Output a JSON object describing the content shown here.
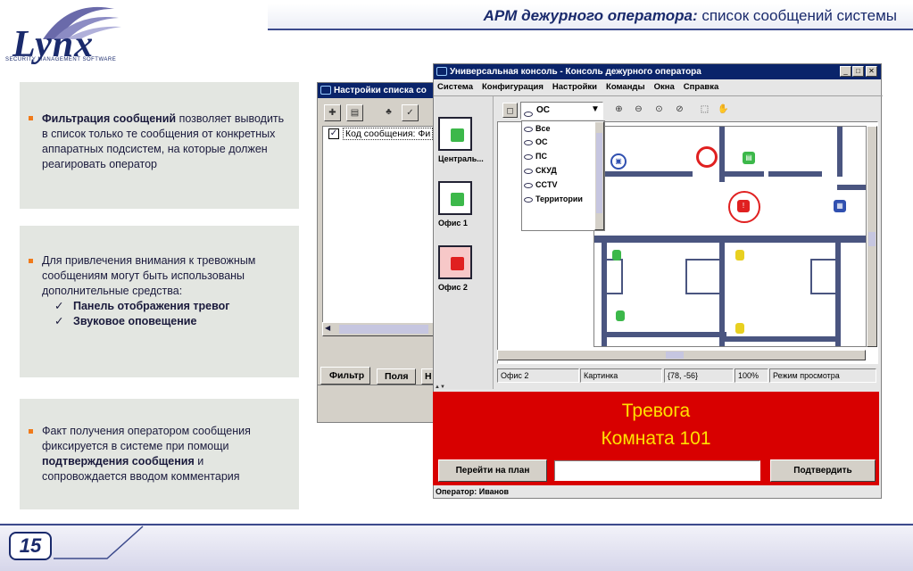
{
  "header": {
    "title_bold": "АРМ дежурного оператора:",
    "title_rest": " список сообщений системы"
  },
  "logo": {
    "name": "Lynx",
    "subtitle": "SECURITY MANAGEMENT SOFTWARE"
  },
  "panels": [
    {
      "bold": "Фильтрация сообщений",
      "text": " позволяет выводить в список только те сообщения от конкретных аппаратных подсистем, на которые должен реагировать оператор"
    },
    {
      "text": "Для привлечения внимания к тревожным сообщениям могут быть использованы дополнительные средства:",
      "checks": [
        "Панель отображения тревог",
        "Звуковое оповещение"
      ]
    },
    {
      "text_before": "Факт получения оператором сообщения фиксируется в системе при помощи ",
      "bold": "подтверждения сообщения",
      "text_after": " и сопровождается вводом комментария"
    }
  ],
  "back_window": {
    "title": "Настройки списка со",
    "tree_item": "Код сообщения: Фи",
    "tabs": [
      "Фильтр",
      "Поля",
      "Н"
    ]
  },
  "console": {
    "title": "Универсальная консоль - Консоль дежурного оператора",
    "menu": [
      "Система",
      "Конфигурация",
      "Настройки",
      "Команды",
      "Окна",
      "Справка"
    ],
    "rooms": [
      {
        "label": "Централь...",
        "state": "green"
      },
      {
        "label": "Офис 1",
        "state": "green"
      },
      {
        "label": "Офис 2",
        "state": "red"
      }
    ],
    "combo_value": "ОС",
    "dropdown": [
      "Все",
      "ОС",
      "ПС",
      "СКУД",
      "CCTV",
      "Территории"
    ],
    "status": [
      "Офис 2",
      "Картинка",
      "{78, -56}",
      "100%",
      "Режим просмотра"
    ],
    "alarm": {
      "line1": "Тревога",
      "line2": "Комната 101",
      "goto_button": "Перейти на план",
      "comment_value": "",
      "confirm_button": "Подтвердить"
    },
    "operator": "Оператор: Иванов"
  },
  "footer": {
    "page": "15"
  },
  "colors": {
    "accent": "#1a2a6c",
    "bullet": "#f07a1a",
    "alarm": "#d80000",
    "alarm_text": "#ffe000"
  }
}
